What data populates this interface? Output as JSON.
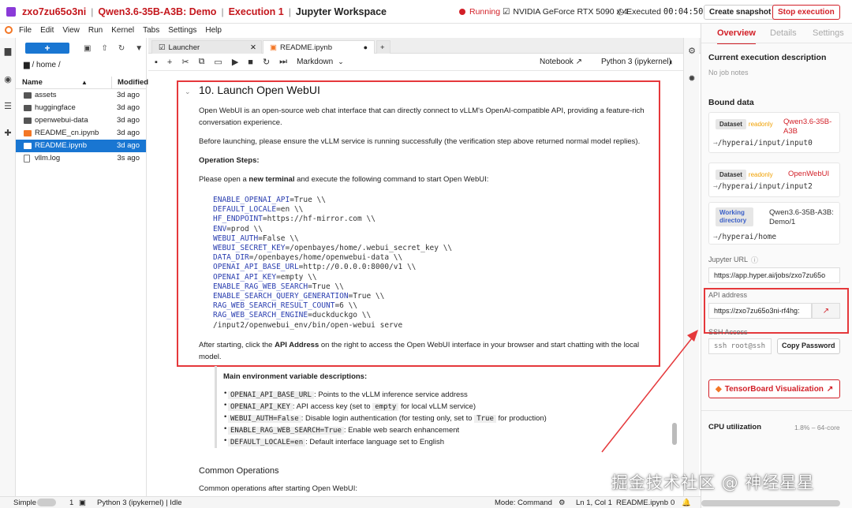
{
  "topbar": {
    "job_id": "zxo7zu65o3ni",
    "model": "Qwen3.6-35B-A3B: Demo",
    "execution": "Execution 1",
    "workspace": "Jupyter Workspace",
    "status": "Running",
    "gpu": "NVIDIA GeForce RTX 5090 x 4",
    "executed_label": "Executed",
    "executed_time": "00:04:50",
    "snapshot_btn": "Create snapshot",
    "stop_btn": "Stop execution"
  },
  "menu": [
    "File",
    "Edit",
    "View",
    "Run",
    "Kernel",
    "Tabs",
    "Settings",
    "Help"
  ],
  "filebrowser": {
    "new_label": "+",
    "breadcrumb": "/ home /",
    "col_name": "Name",
    "col_modified": "Modified",
    "files": [
      {
        "name": "assets",
        "modified": "3d ago"
      },
      {
        "name": "huggingface",
        "modified": "3d ago"
      },
      {
        "name": "openwebui-data",
        "modified": "3d ago"
      },
      {
        "name": "README_cn.ipynb",
        "modified": "3d ago"
      },
      {
        "name": "README.ipynb",
        "modified": "3d ago"
      },
      {
        "name": "vllm.log",
        "modified": "3s ago"
      }
    ]
  },
  "tabs": [
    {
      "label": "Launcher"
    },
    {
      "label": "README.ipynb"
    }
  ],
  "nbtoolbar": {
    "celltype": "Markdown",
    "notebook": "Notebook",
    "kernel": "Python 3 (ipykernel)"
  },
  "notebook": {
    "heading": "10. Launch Open WebUI",
    "p1": "Open WebUI is an open-source web chat interface that can directly connect to vLLM's OpenAI-compatible API, providing a feature-rich",
    "p1b": "conversation experience.",
    "p2": "Before launching, please ensure the vLLM service is running successfully (the verification step above returned normal model replies).",
    "steps": "Operation Steps:",
    "p3a": "Please open a ",
    "p3b": "new terminal",
    "p3c": " and execute the following command to start Open WebUI:",
    "code": [
      {
        "k": "ENABLE_OPENAI_API",
        "v": "=True \\\\"
      },
      {
        "k": "DEFAULT_LOCALE",
        "v": "=en \\\\"
      },
      {
        "k": "HF_ENDPOINT",
        "v": "=https://hf-mirror.com \\\\"
      },
      {
        "k": "ENV",
        "v": "=prod \\\\"
      },
      {
        "k": "WEBUI_AUTH",
        "v": "=False \\\\"
      },
      {
        "k": "WEBUI_SECRET_KEY",
        "v": "=/openbayes/home/.webui_secret_key \\\\"
      },
      {
        "k": "DATA_DIR",
        "v": "=/openbayes/home/openwebui-data \\\\"
      },
      {
        "k": "OPENAI_API_BASE_URL",
        "v": "=http://0.0.0.0:8000/v1 \\\\"
      },
      {
        "k": "OPENAI_API_KEY",
        "v": "=empty \\\\"
      },
      {
        "k": "ENABLE_RAG_WEB_SEARCH",
        "v": "=True \\\\"
      },
      {
        "k": "ENABLE_SEARCH_QUERY_GENERATION",
        "v": "=True \\\\"
      },
      {
        "k": "RAG_WEB_SEARCH_RESULT_COUNT",
        "v": "=6 \\\\"
      },
      {
        "k": "RAG_WEB_SEARCH_ENGINE",
        "v": "=duckduckgo \\\\"
      },
      {
        "k": "",
        "v": "/input2/openwebui_env/bin/open-webui serve"
      }
    ],
    "p4a": "After starting, click the ",
    "p4b": "API Address",
    "p4c": " on the right to access the Open WebUI interface in your browser and start chatting with the local",
    "p4d": "model.",
    "env_title": "Main environment variable descriptions:",
    "envs": [
      {
        "c": "OPENAI_API_BASE_URL",
        "t": ": Points to the vLLM inference service address"
      },
      {
        "c": "OPENAI_API_KEY",
        "t": ": API access key (set to",
        "c2": "empty",
        "t2": "for local vLLM service)"
      },
      {
        "c": "WEBUI_AUTH=False",
        "t": ": Disable login authentication (for testing only, set to",
        "c2": "True",
        "t2": "for production)"
      },
      {
        "c": "ENABLE_RAG_WEB_SEARCH=True",
        "t": ": Enable web search enhancement"
      },
      {
        "c": "DEFAULT_LOCALE=en",
        "t": ": Default interface language set to English"
      }
    ],
    "common_title": "Common Operations",
    "common_p": "Common operations after starting Open WebUI:"
  },
  "panel": {
    "tabs": [
      "Overview",
      "Details",
      "Settings"
    ],
    "exec_desc_title": "Current execution description",
    "exec_desc_value": "No job notes",
    "bound_title": "Bound data",
    "bound": [
      {
        "tag": "Dataset",
        "ro": "readonly",
        "name": "Qwen3.6-35B-A3B",
        "path": "/hyperai/input/input0"
      },
      {
        "tag": "Dataset",
        "ro": "readonly",
        "name": "OpenWebUI",
        "path": "/hyperai/input/input2"
      },
      {
        "tag": "Working directory",
        "ro": "",
        "name": "Qwen3.6-35B-A3B: Demo/1",
        "path": "/hyperai/home"
      }
    ],
    "jupyter_label": "Jupyter URL",
    "jupyter_url": "https://app.hyper.ai/jobs/zxo7zu65o",
    "api_label": "API address",
    "api_url": "https://zxo7zu65o3ni-rf4hg:",
    "ssh_label": "SSH Access",
    "ssh_value": "ssh root@ssh",
    "copy_btn": "Copy Password",
    "tensorboard": "TensorBoard Visualization",
    "cpu_label": "CPU utilization",
    "cpu_value": "1.8% – 64-core"
  },
  "status": {
    "mode": "Simple",
    "count": "1",
    "kernel": "Python 3 (ipykernel) | Idle",
    "cmd": "Mode: Command",
    "pos": "Ln 1, Col 1",
    "file": "README.ipynb",
    "zero": "0"
  },
  "watermark": "掘金技术社区 @ 神经星星"
}
